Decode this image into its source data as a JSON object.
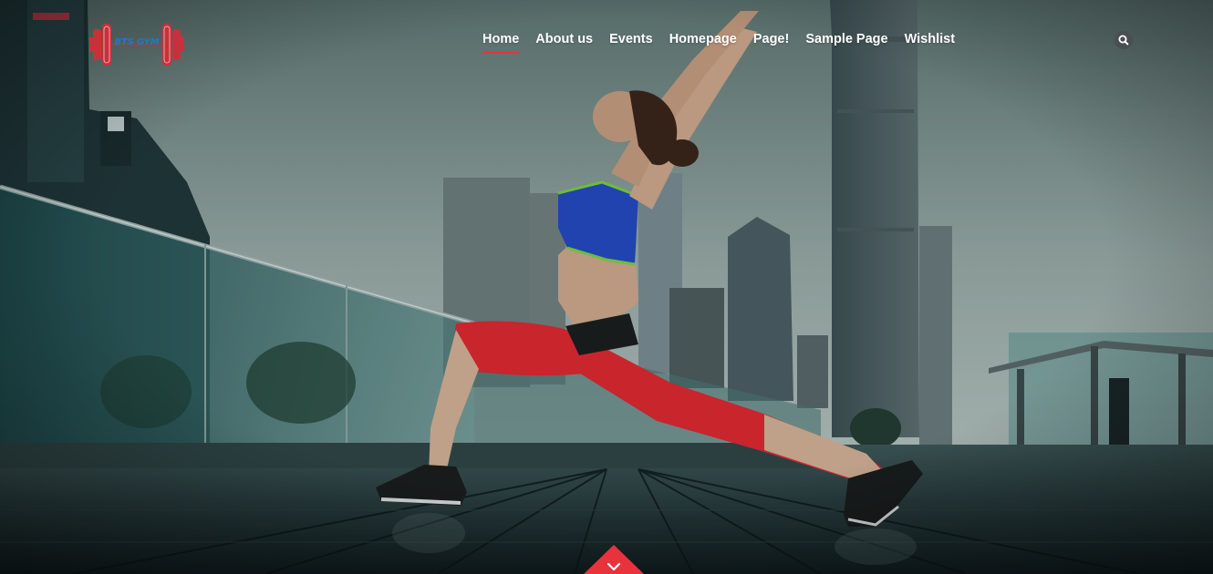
{
  "brand": {
    "logo_text": "BTS GYM",
    "accent_color": "#e8333c",
    "logo_text_color": "#1f78c9"
  },
  "nav": {
    "items": [
      {
        "label": "Home",
        "active": true
      },
      {
        "label": "About us",
        "active": false
      },
      {
        "label": "Events",
        "active": false
      },
      {
        "label": "Homepage",
        "active": false
      },
      {
        "label": "Page!",
        "active": false
      },
      {
        "label": "Sample Page",
        "active": false
      },
      {
        "label": "Wishlist",
        "active": false
      }
    ],
    "search_icon": "search-icon"
  },
  "hero": {
    "scroll_icon": "chevron-down-icon"
  }
}
